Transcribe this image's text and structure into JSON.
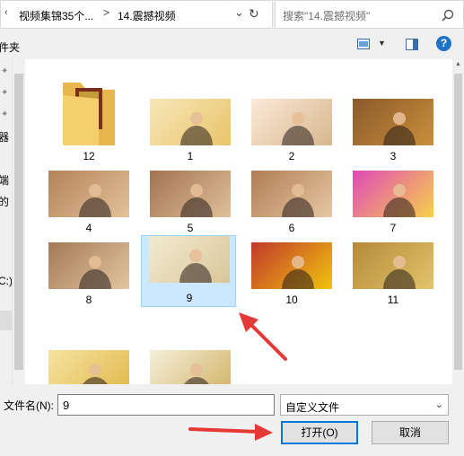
{
  "address": {
    "crumb1": "视频集锦35个...",
    "crumb2": "14.震撼视频",
    "separator": ">",
    "dropdown_icon": "chevron-down-icon",
    "refresh_icon": "refresh-icon"
  },
  "search": {
    "placeholder": "搜索\"14.震撼视频\"",
    "icon": "search-icon"
  },
  "toolbar": {
    "left_label": "件夹",
    "help_label": "?"
  },
  "nav": {
    "texts": [
      "器",
      "端",
      "的",
      "C:)"
    ]
  },
  "files": [
    {
      "name": "12",
      "kind": "folder"
    },
    {
      "name": "1",
      "kind": "image"
    },
    {
      "name": "2",
      "kind": "image"
    },
    {
      "name": "3",
      "kind": "image"
    },
    {
      "name": "4",
      "kind": "image"
    },
    {
      "name": "5",
      "kind": "image"
    },
    {
      "name": "6",
      "kind": "image"
    },
    {
      "name": "7",
      "kind": "image"
    },
    {
      "name": "8",
      "kind": "image"
    },
    {
      "name": "9",
      "kind": "image",
      "selected": true
    },
    {
      "name": "10",
      "kind": "image"
    },
    {
      "name": "11",
      "kind": "image"
    },
    {
      "name": "",
      "kind": "image"
    },
    {
      "name": "",
      "kind": "image"
    }
  ],
  "filename": {
    "label": "文件名(N):",
    "value": "9"
  },
  "filetype": {
    "value": "自定义文件"
  },
  "buttons": {
    "open": "打开(O)",
    "cancel": "取消"
  },
  "colors": {
    "selection": "#cce8ff",
    "accent": "#0078d7",
    "arrow": "#e53935"
  }
}
